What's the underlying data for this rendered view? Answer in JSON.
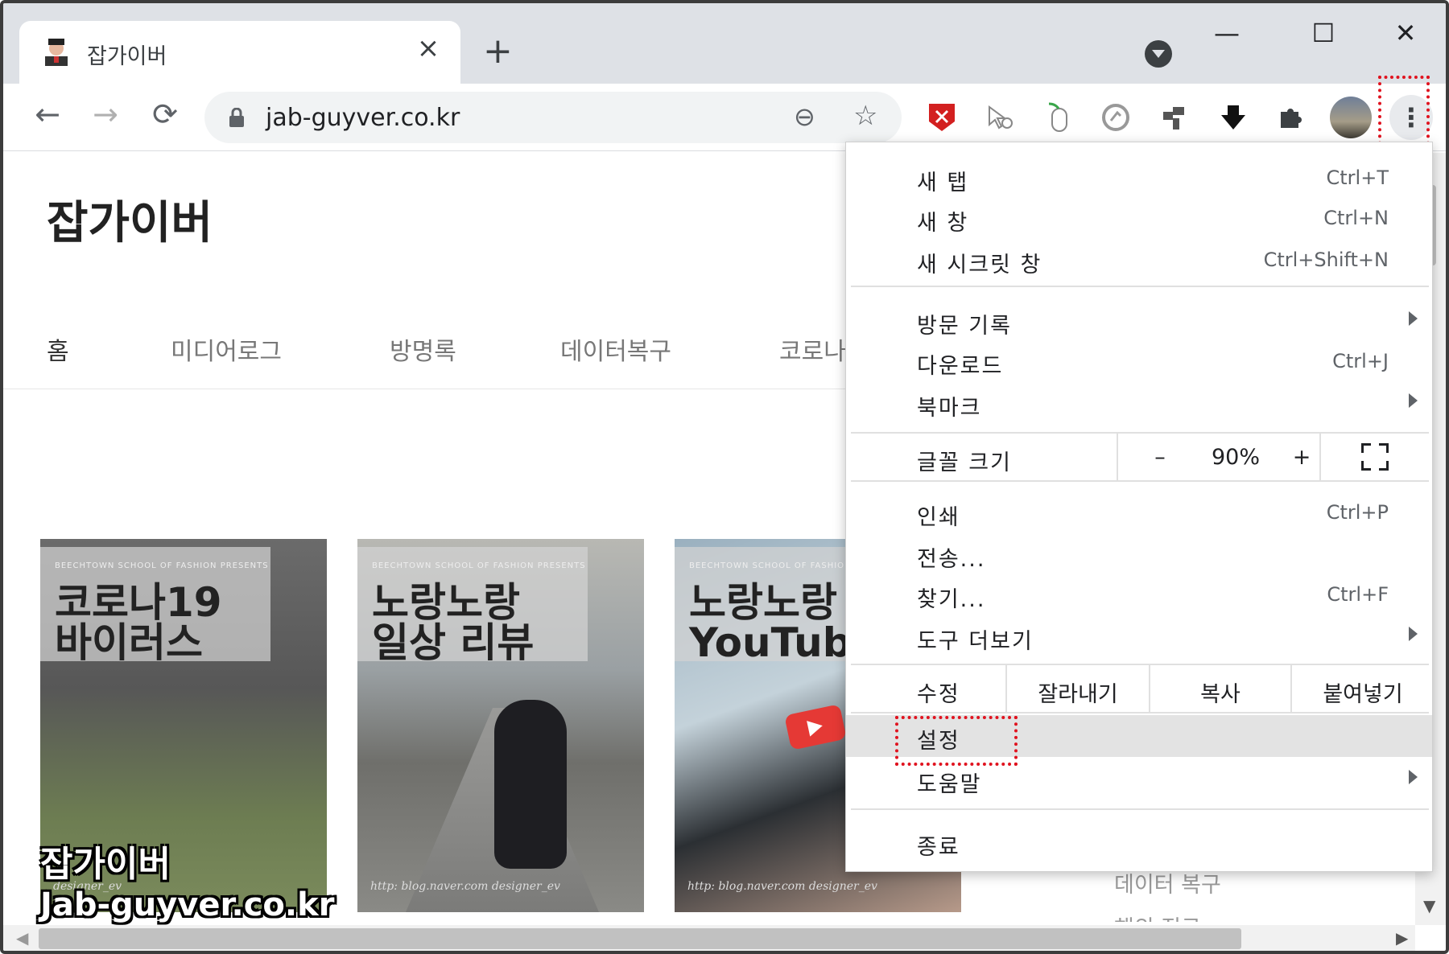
{
  "tab": {
    "title": "잡가이버",
    "close": "×",
    "new_tab": "+"
  },
  "window_controls": {
    "minimize": "—",
    "maximize": "☐",
    "close": "✕"
  },
  "toolbar": {
    "back": "←",
    "forward": "→",
    "reload": "⟳",
    "url": "jab-guyver.co.kr",
    "zoom_icon": "⊖",
    "star_icon": "☆",
    "menu_icon": "⋮"
  },
  "page": {
    "site_title": "잡가이버",
    "nav": [
      "홈",
      "미디어로그",
      "방명록",
      "데이터복구",
      "코로나"
    ],
    "cards": [
      {
        "title": "코로나19\n바이러스",
        "subtitle": "BEECHTOWN SCHOOL OF FASHION PRESENTS",
        "footer": "designer_ev"
      },
      {
        "title": "노랑노랑\n일상 리뷰",
        "subtitle": "BEECHTOWN SCHOOL OF FASHION PRESENTS",
        "footer": "http: blog.naver.com designer_ev"
      },
      {
        "title": "노랑노랑\nYouTube",
        "subtitle": "BEECHTOWN SCHOOL OF FASHION P",
        "footer": "http: blog.naver.com designer_ev"
      }
    ],
    "sidebar_bg": [
      "데이터 복구",
      "해외 직구"
    ],
    "watermark": {
      "line1": "잡가이버",
      "line2": "Jab-guyver.co.kr"
    }
  },
  "menu": {
    "group1": [
      {
        "label": "새 탭",
        "shortcut": "Ctrl+T"
      },
      {
        "label": "새 창",
        "shortcut": "Ctrl+N"
      },
      {
        "label": "새 시크릿 창",
        "shortcut": "Ctrl+Shift+N"
      }
    ],
    "group2": [
      {
        "label": "방문 기록",
        "shortcut": ""
      },
      {
        "label": "다운로드",
        "shortcut": "Ctrl+J"
      },
      {
        "label": "북마크",
        "shortcut": ""
      }
    ],
    "zoom": {
      "label": "글꼴 크기",
      "minus": "–",
      "value": "90%",
      "plus": "+"
    },
    "group3": [
      {
        "label": "인쇄",
        "shortcut": "Ctrl+P"
      },
      {
        "label": "전송...",
        "shortcut": ""
      },
      {
        "label": "찾기...",
        "shortcut": "Ctrl+F"
      },
      {
        "label": "도구 더보기",
        "shortcut": ""
      }
    ],
    "edit": {
      "label": "수정",
      "cut": "잘라내기",
      "copy": "복사",
      "paste": "붙여넣기"
    },
    "group4": [
      {
        "label": "설정",
        "shortcut": ""
      },
      {
        "label": "도움말",
        "shortcut": ""
      }
    ],
    "exit": {
      "label": "종료"
    }
  },
  "colors": {
    "highlight": "#e0131f",
    "tabstrip": "#dee1e6",
    "active_item": "#e3e3e3"
  }
}
